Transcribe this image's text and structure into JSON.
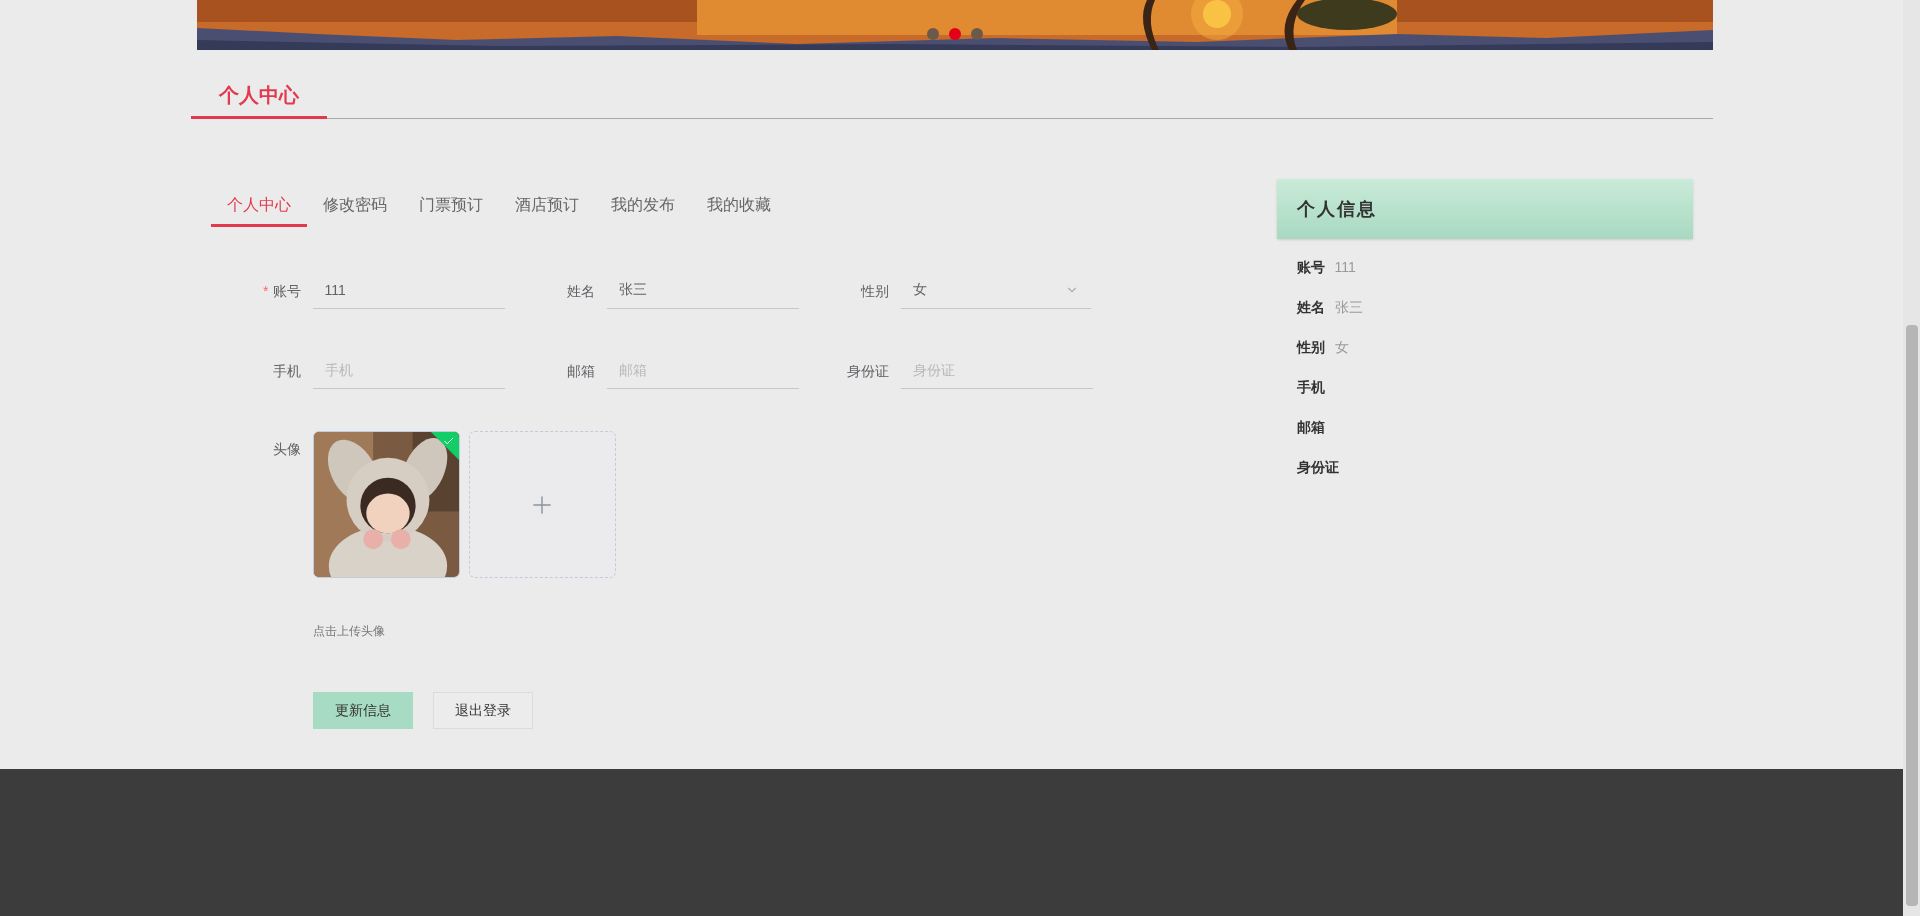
{
  "banner": {
    "dots": [
      {
        "selected": false
      },
      {
        "selected": true
      },
      {
        "selected": false
      }
    ]
  },
  "page_title": "个人中心",
  "tabs": [
    {
      "label": "个人中心",
      "selected": true
    },
    {
      "label": "修改密码",
      "selected": false
    },
    {
      "label": "门票预订",
      "selected": false
    },
    {
      "label": "酒店预订",
      "selected": false
    },
    {
      "label": "我的发布",
      "selected": false
    },
    {
      "label": "我的收藏",
      "selected": false
    }
  ],
  "form": {
    "required_mark": "*",
    "fields": [
      {
        "kind": "text",
        "label": "账号",
        "required": true,
        "value": "111"
      },
      {
        "kind": "text",
        "label": "姓名",
        "required": false,
        "value": "张三"
      },
      {
        "kind": "select",
        "label": "性别",
        "required": false,
        "value": "女"
      },
      {
        "kind": "text",
        "label": "手机",
        "required": false,
        "placeholder": "手机"
      },
      {
        "kind": "text",
        "label": "邮箱",
        "required": false,
        "placeholder": "邮箱"
      },
      {
        "kind": "text",
        "label": "身份证",
        "required": false,
        "placeholder": "身份证"
      }
    ],
    "avatar": {
      "label": "头像",
      "uploaded": true,
      "hint": "点击上传头像"
    },
    "buttons": [
      {
        "label": "更新信息",
        "kind": "primary"
      },
      {
        "label": "退出登录",
        "kind": "default"
      }
    ]
  },
  "profile_card": {
    "title": "个人信息",
    "items": [
      {
        "label": "账号",
        "value": "111"
      },
      {
        "label": "姓名",
        "value": "张三"
      },
      {
        "label": "性别",
        "value": "女"
      },
      {
        "label": "手机"
      },
      {
        "label": "邮箱"
      },
      {
        "label": "身份证"
      }
    ]
  }
}
